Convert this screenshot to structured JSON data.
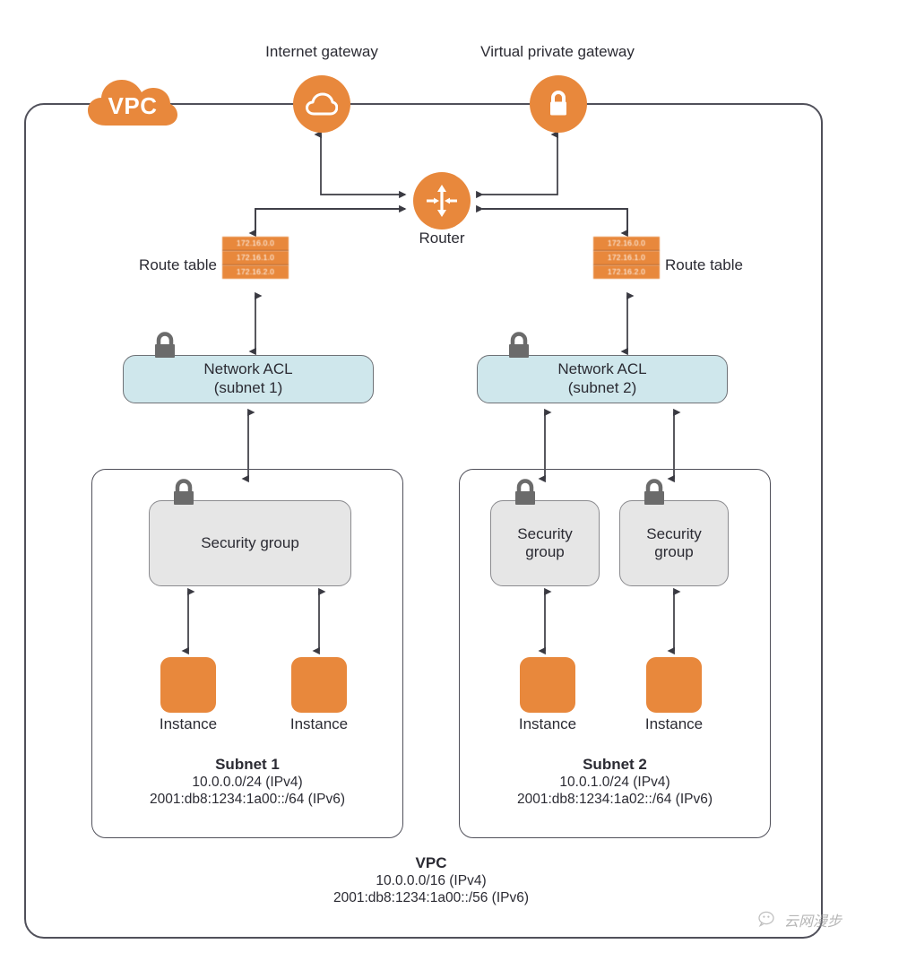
{
  "diagram": {
    "title_badge": "VPC",
    "gateways": [
      {
        "label": "Internet gateway",
        "icon": "cloud-icon"
      },
      {
        "label": "Virtual private gateway",
        "icon": "lock-icon"
      }
    ],
    "router": {
      "label": "Router",
      "icon": "router-icon"
    },
    "route_tables": [
      {
        "label": "Route table",
        "side": "left",
        "rows": [
          "172.16.0.0",
          "172.16.1.0",
          "172.16.2.0"
        ]
      },
      {
        "label": "Route table",
        "side": "right",
        "rows": [
          "172.16.0.0",
          "172.16.1.0",
          "172.16.2.0"
        ]
      }
    ],
    "network_acls": [
      {
        "line1": "Network ACL",
        "line2": "(subnet 1)"
      },
      {
        "line1": "Network ACL",
        "line2": "(subnet 2)"
      }
    ],
    "subnets": [
      {
        "name": "Subnet 1",
        "ipv4": "10.0.0.0/24 (IPv4)",
        "ipv6": "2001:db8:1234:1a00::/64 (IPv6)",
        "security_groups": [
          {
            "line1": "Security group",
            "line2": ""
          }
        ],
        "instances": [
          {
            "label": "Instance"
          },
          {
            "label": "Instance"
          }
        ]
      },
      {
        "name": "Subnet 2",
        "ipv4": "10.0.1.0/24 (IPv4)",
        "ipv6": "2001:db8:1234:1a02::/64 (IPv6)",
        "security_groups": [
          {
            "line1": "Security",
            "line2": "group"
          },
          {
            "line1": "Security",
            "line2": "group"
          }
        ],
        "instances": [
          {
            "label": "Instance"
          },
          {
            "label": "Instance"
          }
        ]
      }
    ],
    "vpc_footer": {
      "name": "VPC",
      "ipv4": "10.0.0.0/16 (IPv4)",
      "ipv6": "2001:db8:1234:1a00::/56 (IPv6)"
    },
    "watermark": {
      "text": "云网漫步",
      "icon": "wechat-icon"
    },
    "colors": {
      "orange": "#e8883c",
      "acl_blue": "#cfe7ec",
      "sg_gray": "#e6e6e6",
      "lock_gray": "#6b6b6b",
      "line": "#50505a"
    }
  }
}
